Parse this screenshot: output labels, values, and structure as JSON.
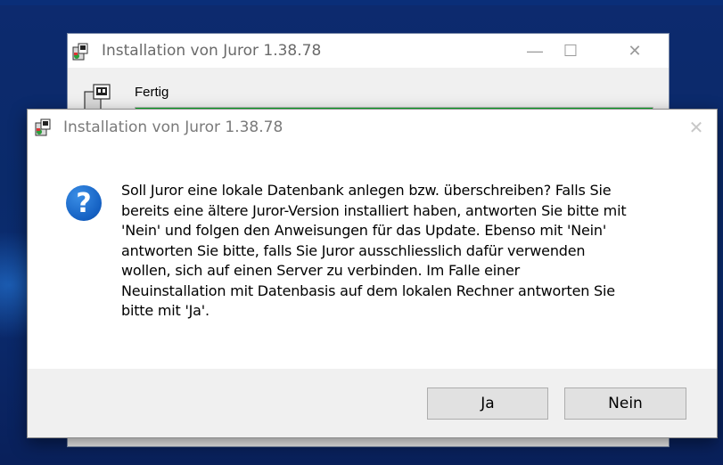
{
  "background_window": {
    "title": "Installation von Juror 1.38.78",
    "step_label": "Fertig",
    "progress": 1.0,
    "controls": {
      "minimize": "—",
      "maximize": "☐",
      "close": "✕"
    }
  },
  "dialog": {
    "title": "Installation von Juror 1.38.78",
    "close_glyph": "✕",
    "icon": "question-icon",
    "icon_glyph": "?",
    "message": "Soll Juror eine lokale Datenbank anlegen bzw. überschreiben?  Falls Sie\nbereits eine ältere Juror-Version installiert haben, antworten Sie bitte mit\n'Nein' und folgen den Anweisungen für das Update. Ebenso mit 'Nein'\nantworten Sie bitte, falls Sie Juror ausschliesslich dafür verwenden\nwollen, sich auf einen Server zu verbinden. Im Falle einer\nNeuinstallation mit Datenbasis auf dem lokalen Rechner antworten Sie\nbitte mit 'Ja'.",
    "buttons": {
      "yes": "Ja",
      "no": "Nein"
    }
  },
  "colors": {
    "progress_fill": "#06b025",
    "question_icon": "#1460c2"
  }
}
